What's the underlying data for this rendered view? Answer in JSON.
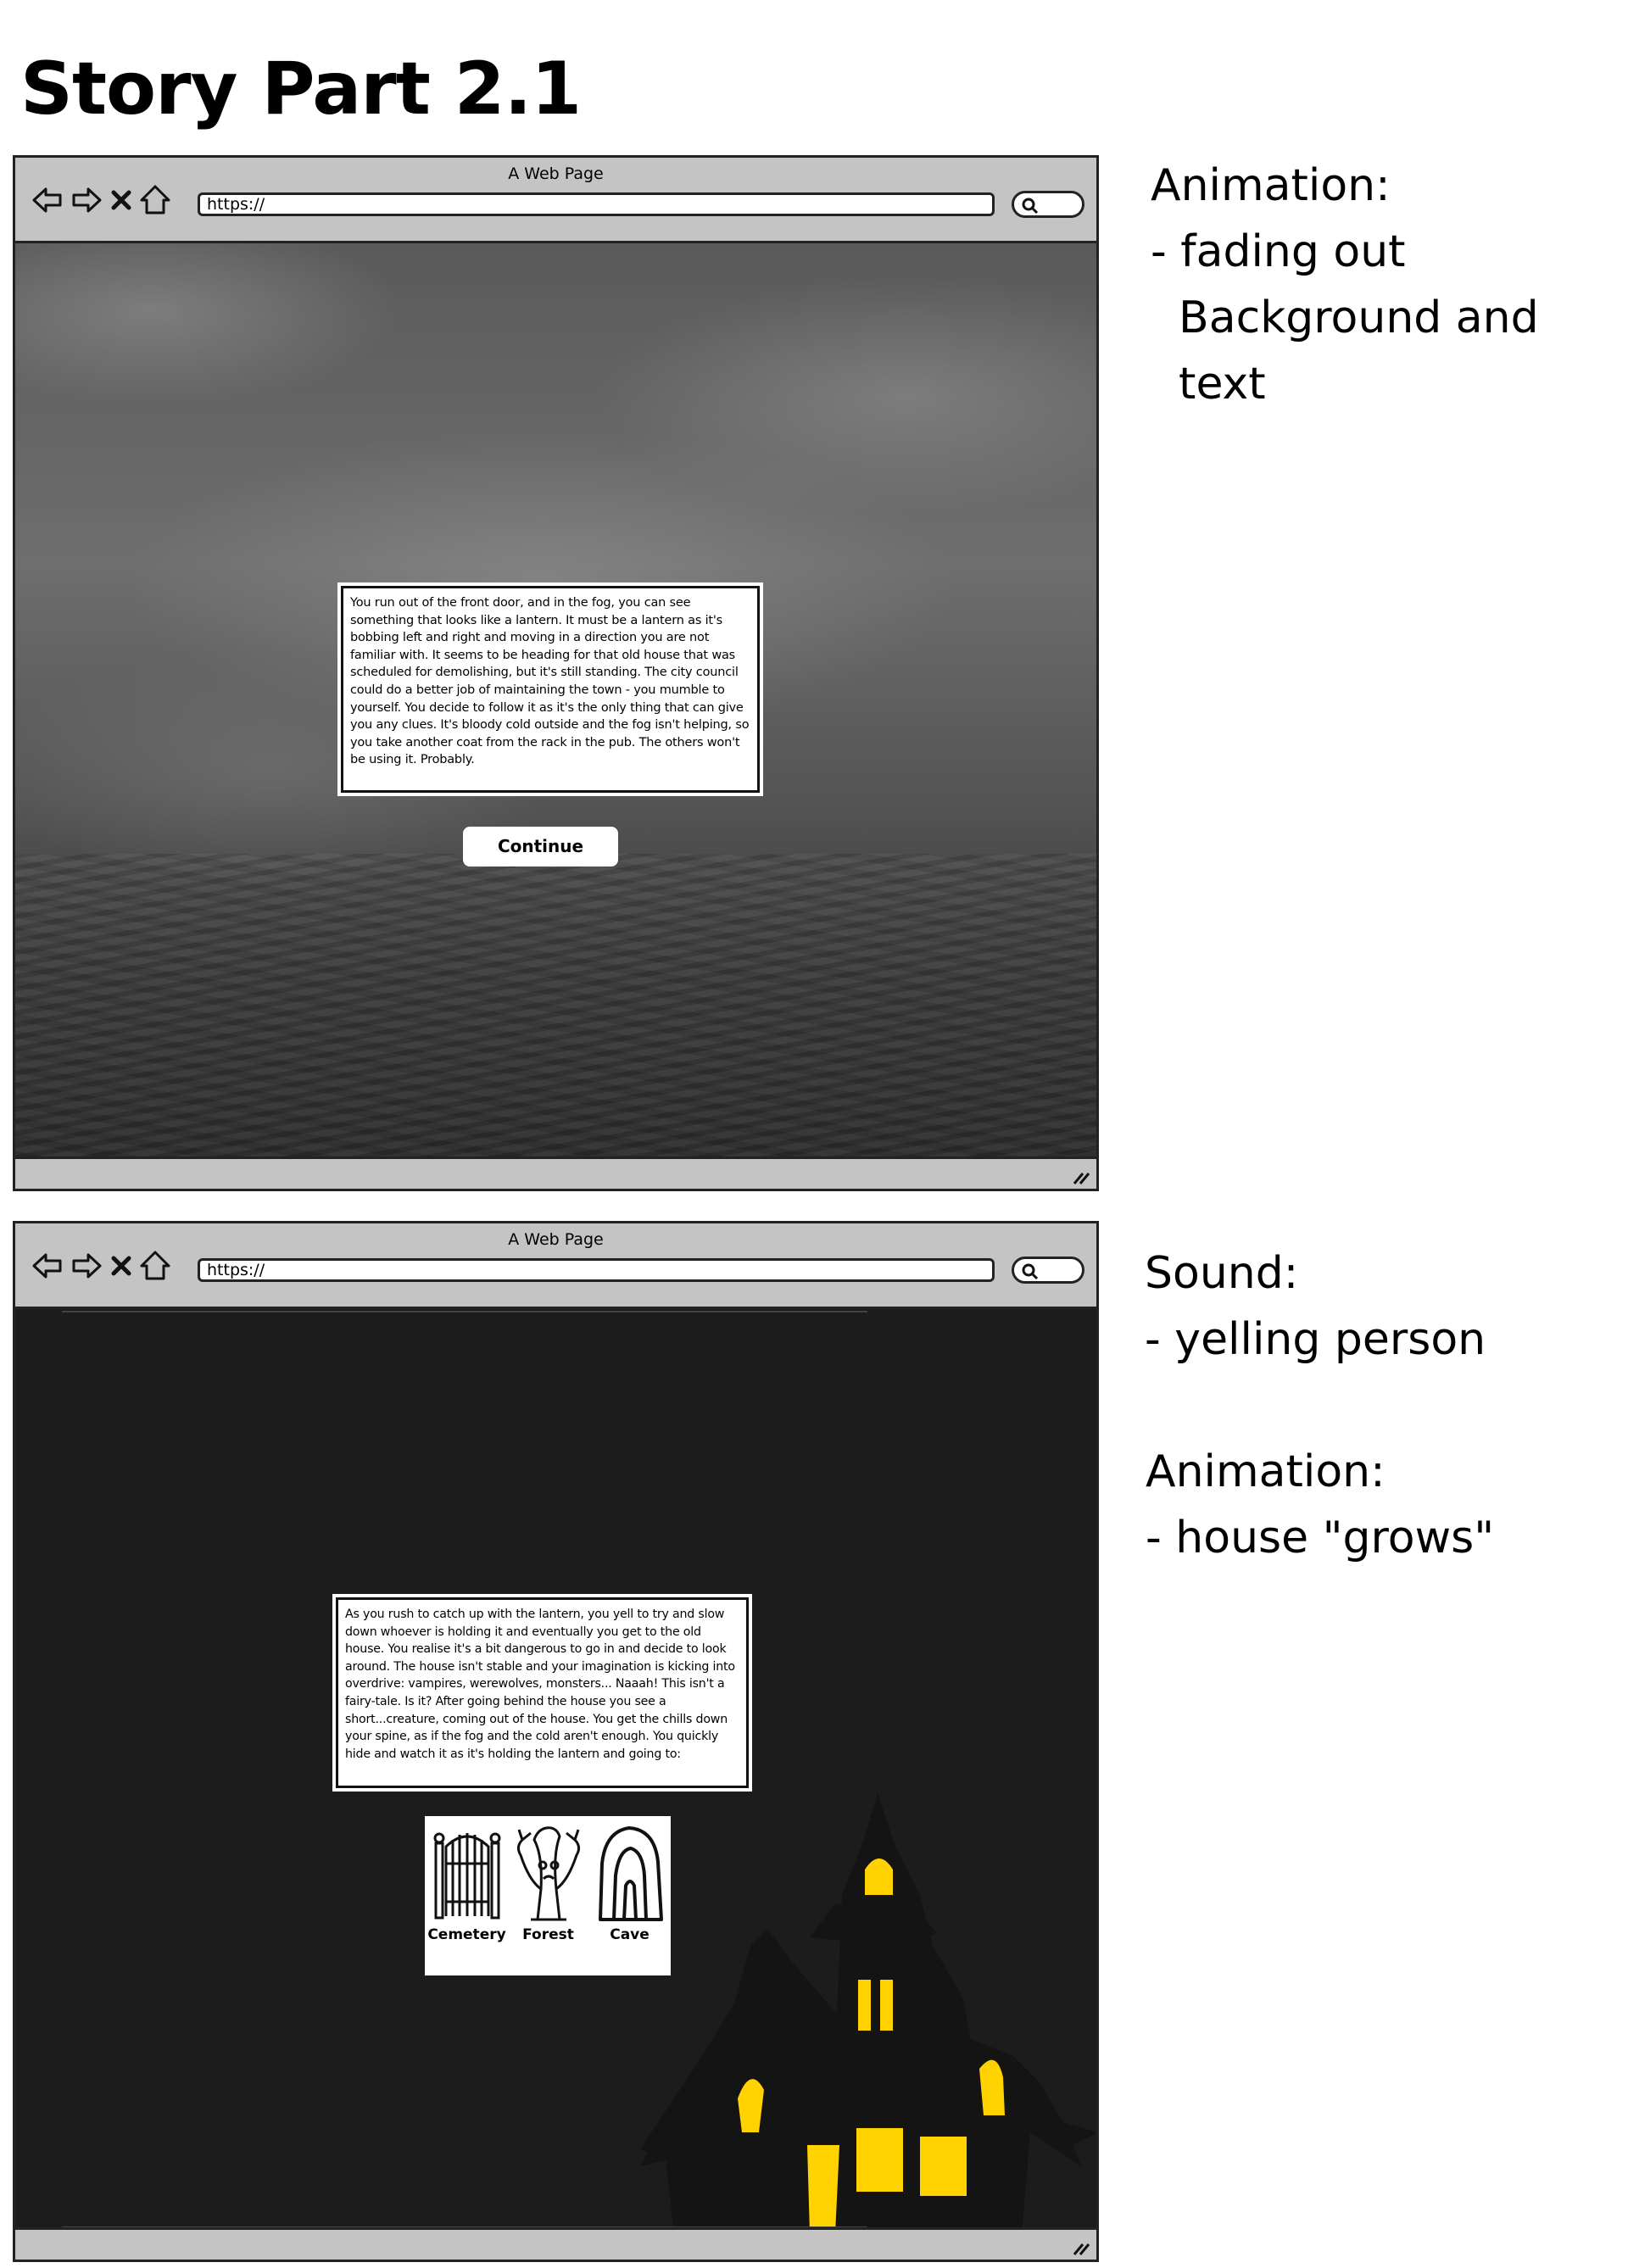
{
  "page": {
    "title": "Story Part 2.1"
  },
  "browser1": {
    "window_title": "A Web Page",
    "url": "https://",
    "story_text": "You run out of the front door, and in the fog, you can see something that looks like a lantern. It must be a lantern as it's bobbing left and right and moving in a direction you are not familiar with. It seems to be heading for that old house that was scheduled for demolishing, but it's still standing. The city council could do a better job of maintaining the town - you mumble to yourself. You decide to follow it as it's the only thing that can give you any clues. It's bloody cold outside and the fog isn't helping, so you take another coat from the rack in the pub. The others won't be using it. Probably.",
    "continue_label": "Continue"
  },
  "browser2": {
    "window_title": "A Web Page",
    "url": "https://",
    "story_text": "As you rush to catch up with the lantern, you yell to try and slow down whoever is holding it and eventually you get to the old house. You realise it's a bit dangerous to go in and decide to look around. The house isn't stable and your imagination is kicking into overdrive: vampires, werewolves, monsters... Naaah! This isn't a fairy-tale. Is it? After going behind the house you see a short...creature, coming out of the house. You get the chills down your spine, as if the fog and the cold aren't enough. You quickly hide and watch it as it's holding the lantern and going to:",
    "choices": [
      {
        "label": "Cemetery",
        "icon": "cemetery-gate-icon"
      },
      {
        "label": "Forest",
        "icon": "spooky-tree-icon"
      },
      {
        "label": "Cave",
        "icon": "cave-icon"
      }
    ],
    "house_colors": {
      "silhouette": "#141414",
      "windows": "#ffd200"
    }
  },
  "notes": {
    "note1": {
      "heading": "Animation:",
      "lines": [
        "- fading out",
        "  Background and",
        "  text"
      ]
    },
    "note2": {
      "heading1": "Sound:",
      "line1": "- yelling person",
      "heading2": "Animation:",
      "line2": "- house \"grows\""
    }
  }
}
